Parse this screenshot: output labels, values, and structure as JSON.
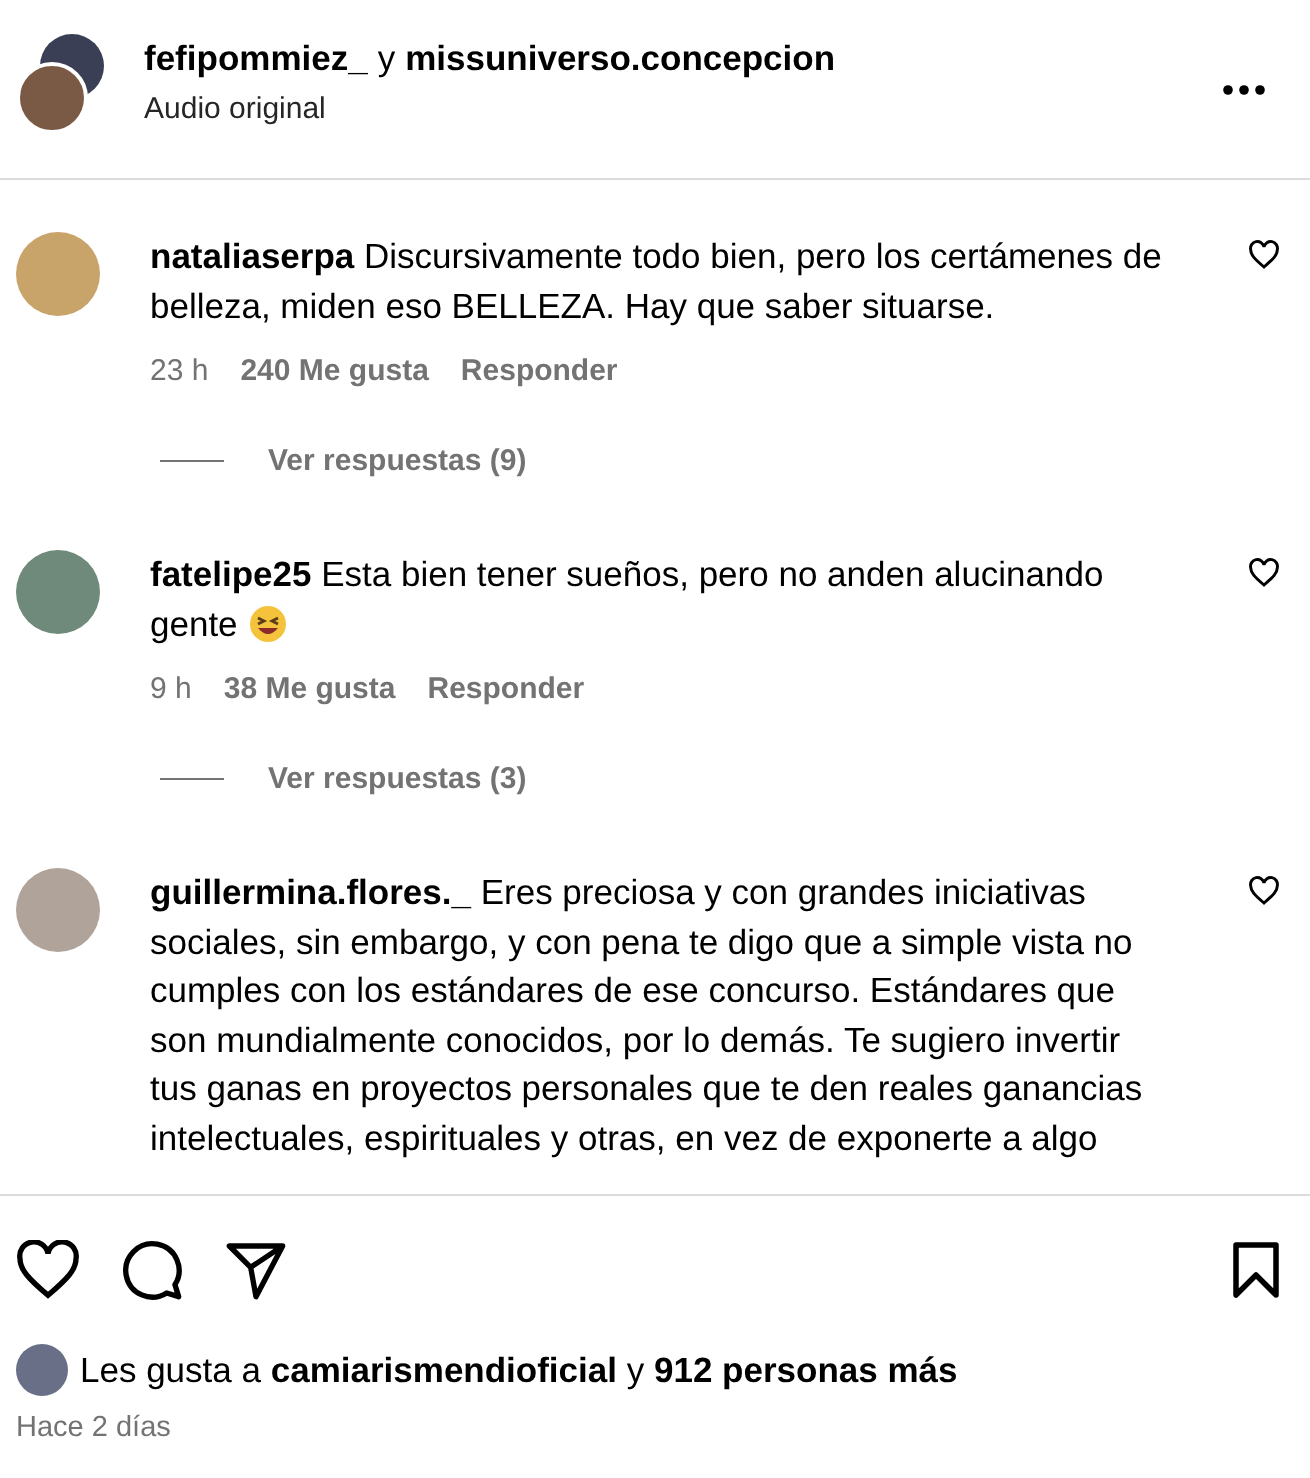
{
  "header": {
    "users": [
      "fefipommiez_",
      "missuniverso.concepcion"
    ],
    "joiner": "y",
    "subtitle": "Audio original",
    "avatars": [
      {
        "color": "#3b3f55"
      },
      {
        "color": "#7a5a44"
      }
    ]
  },
  "comments": [
    {
      "user": "nataliaserpa",
      "text": "Discursivamente todo bien, pero los certámenes de belleza, miden eso BELLEZA. Hay que saber situarse.",
      "color": "#c9a46a",
      "time": "23 h",
      "likes": "240 Me gusta",
      "reply": "Responder",
      "replies": "Ver respuestas (9)"
    },
    {
      "user": "fatelipe25",
      "text": "Esta bien tener sueños, pero no anden alucinando gente",
      "emoji": true,
      "color": "#6f8a7a",
      "time": "9 h",
      "likes": "38 Me gusta",
      "reply": "Responder",
      "replies": "Ver respuestas (3)"
    },
    {
      "user": "guillermina.flores._",
      "text": "Eres preciosa y con grandes iniciativas sociales, sin embargo, y con pena te digo que a simple vista no cumples con los estándares de ese concurso. Estándares que son mundialmente conocidos, por lo demás. Te sugiero invertir tus ganas en proyectos personales que te den reales ganancias intelectuales, espirituales y otras, en vez de exponerte a algo",
      "color": "#b0a49a"
    }
  ],
  "actions": {
    "liked": false,
    "saved": false
  },
  "likes": {
    "prefix": "Les gusta a",
    "user": "camiarismendioficial",
    "joiner": "y",
    "rest": "912 personas más",
    "color": "#6a6f88"
  },
  "date": "Hace 2 días"
}
